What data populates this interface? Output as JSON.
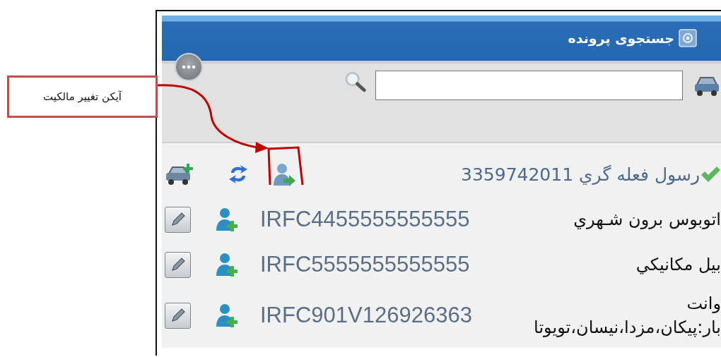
{
  "callout": {
    "text": "آیکن تغییر مالکیت"
  },
  "panel": {
    "title": "جستجوی پرونده"
  },
  "owner": {
    "name": "رسول فعله گري 3359742011"
  },
  "vehicles": [
    {
      "code": "IRFC4455555555555",
      "lines": [
        "اتوبوس برون شـهري"
      ]
    },
    {
      "code": "IRFC5555555555555",
      "lines": [
        "بيل مكانيكي"
      ]
    },
    {
      "code": "IRFC901V126926363",
      "lines": [
        "وانت",
        "بار:پيكان،مزدا،نيسان،تويوتا"
      ]
    }
  ]
}
